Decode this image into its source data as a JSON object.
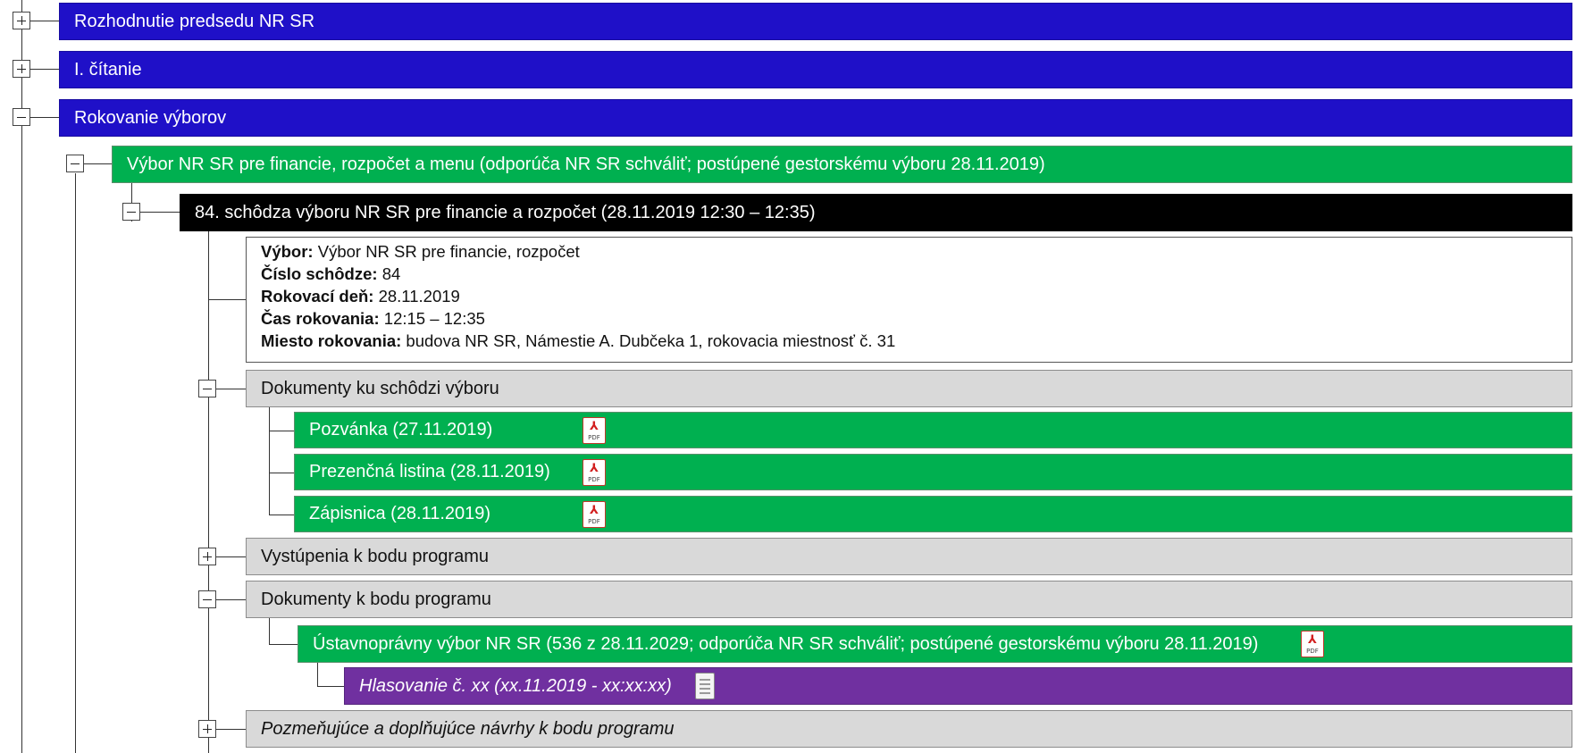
{
  "tree": {
    "rozhodnutie": {
      "label": "Rozhodnutie predsedu NR SR"
    },
    "citanie": {
      "label": "I. čítanie"
    },
    "rokovanie": {
      "label": "Rokovanie výborov"
    },
    "vybor_financie": {
      "label": "Výbor NR SR pre financie, rozpočet a menu (odporúča NR SR schváliť; postúpené gestorskému výboru 28.11.2019)"
    },
    "schodza": {
      "label": "84. schôdza výboru NR SR pre financie a rozpočet  (28.11.2019 12:30 – 12:35)"
    },
    "info": {
      "vybor_label": "Výbor:",
      "vybor_value": " Výbor NR SR pre financie, rozpočet",
      "cislo_label": "Číslo schôdze:",
      "cislo_value": " 84",
      "den_label": "Rokovací deň:",
      "den_value": " 28.11.2019",
      "cas_label": "Čas rokovania:",
      "cas_value": " 12:15 – 12:35",
      "miesto_label": "Miesto rokovania:",
      "miesto_value": " budova NR SR, Námestie A. Dubčeka 1, rokovacia miestnosť č. 31"
    },
    "dokumenty_schodza": {
      "label": "Dokumenty ku schôdzi výboru",
      "items": [
        {
          "label": "Pozvánka (27.11.2019)",
          "icon": "pdf-icon"
        },
        {
          "label": "Prezenčná listina (28.11.2019)",
          "icon": "pdf-icon"
        },
        {
          "label": "Zápisnica (28.11.2019)",
          "icon": "pdf-icon"
        }
      ]
    },
    "vystupenia": {
      "label": "Vystúpenia k bodu programu"
    },
    "dokumenty_bod": {
      "label": "Dokumenty k bodu programu"
    },
    "ustavnopravny": {
      "label": "Ústavnoprávny výbor NR SR (536 z 28.11.2029; odporúča NR SR schváliť; postúpené gestorskému výboru 28.11.2019)",
      "icon": "pdf-icon"
    },
    "hlasovanie": {
      "label": "Hlasovanie č. xx (xx.11.2019 - xx:xx:xx)",
      "icon": "document-icon"
    },
    "pozmenujuce": {
      "label": "Pozmeňujúce a doplňujúce návrhy k bodu programu"
    }
  },
  "pdf_icon": {
    "glyph": "⅄",
    "tag": "PDF"
  },
  "colors": {
    "blue": "#1f10c8",
    "green": "#00b050",
    "black": "#000000",
    "gray": "#d9d9d9",
    "purple": "#7030a0"
  }
}
